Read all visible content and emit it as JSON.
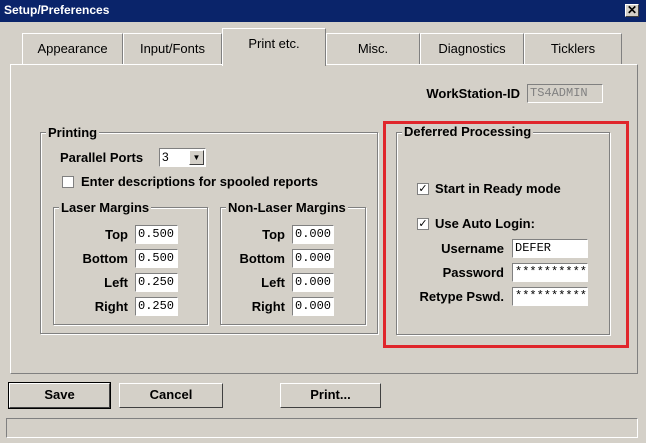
{
  "window": {
    "title": "Setup/Preferences",
    "close_symbol": "✕"
  },
  "tabs": [
    {
      "label": "Appearance"
    },
    {
      "label": "Input/Fonts"
    },
    {
      "label": "Print etc."
    },
    {
      "label": "Misc."
    },
    {
      "label": "Diagnostics"
    },
    {
      "label": "Ticklers"
    }
  ],
  "workstation": {
    "label": "WorkStation-ID",
    "value": "TS4ADMIN"
  },
  "printing": {
    "legend": "Printing",
    "parallel_ports_label": "Parallel Ports",
    "parallel_ports_value": "3",
    "spool_desc_label": "Enter descriptions for spooled reports",
    "spool_desc_checked": false
  },
  "laser_margins": {
    "legend": "Laser Margins",
    "rows": [
      {
        "label": "Top",
        "value": "0.500"
      },
      {
        "label": "Bottom",
        "value": "0.500"
      },
      {
        "label": "Left",
        "value": "0.250"
      },
      {
        "label": "Right",
        "value": "0.250"
      }
    ]
  },
  "nonlaser_margins": {
    "legend": "Non-Laser Margins",
    "rows": [
      {
        "label": "Top",
        "value": "0.000"
      },
      {
        "label": "Bottom",
        "value": "0.000"
      },
      {
        "label": "Left",
        "value": "0.000"
      },
      {
        "label": "Right",
        "value": "0.000"
      }
    ]
  },
  "deferred": {
    "legend": "Deferred Processing",
    "ready_mode_label": "Start in Ready mode",
    "ready_mode_checked": true,
    "auto_login_label": "Use Auto Login:",
    "auto_login_checked": true,
    "username_label": "Username",
    "username_value": "DEFER",
    "password_label": "Password",
    "password_value": "**********",
    "retype_label": "Retype Pswd.",
    "retype_value": "**********",
    "check_symbol": "✓"
  },
  "buttons": {
    "save": "Save",
    "cancel": "Cancel",
    "print": "Print..."
  },
  "colors": {
    "title_bar": "#0a246a",
    "highlight": "#e0262c",
    "face": "#d4d0c8"
  }
}
